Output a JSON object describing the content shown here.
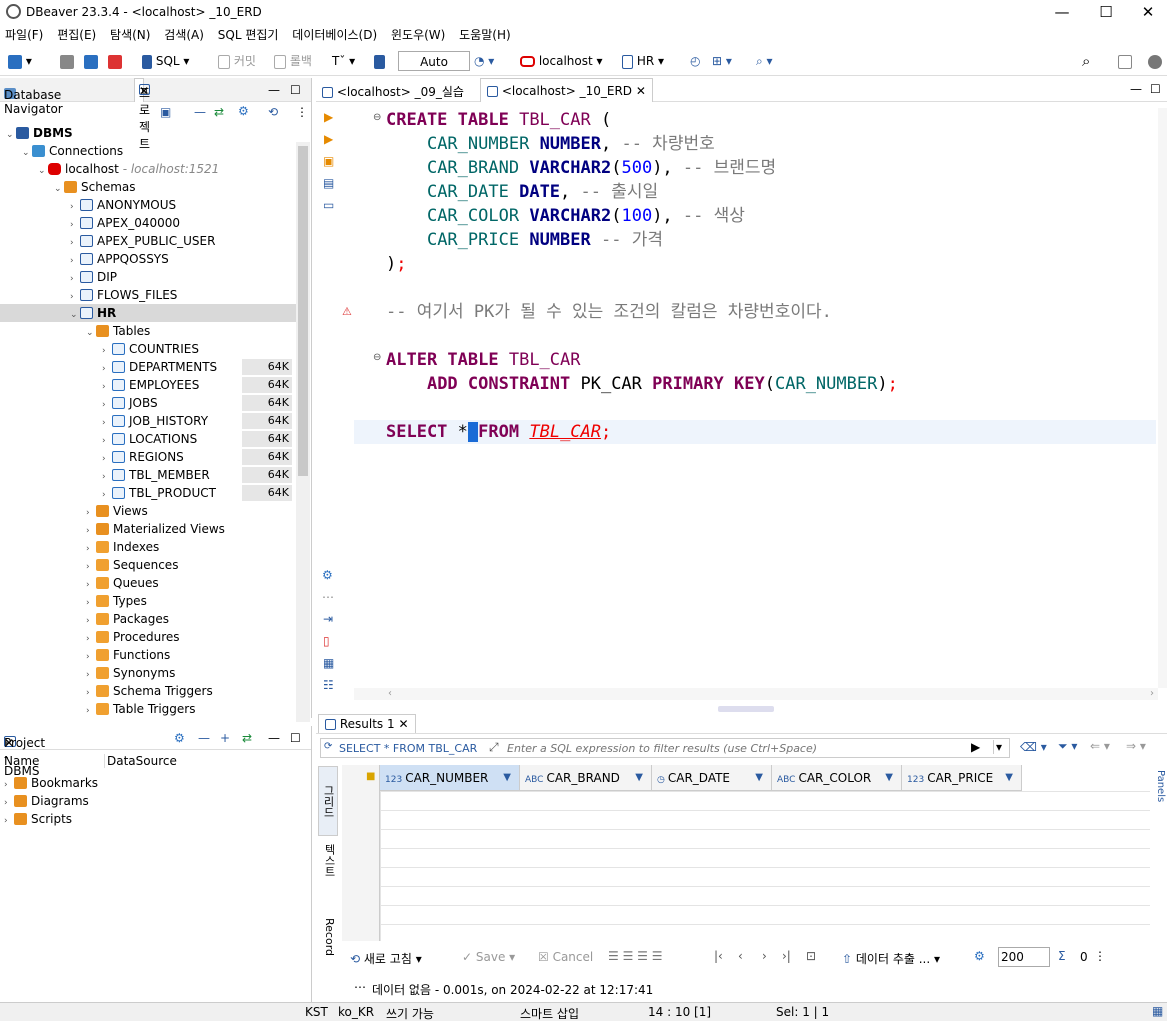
{
  "window": {
    "title": "DBeaver 23.3.4 - <localhost> _10_ERD",
    "minimize": "—",
    "maximize": "☐",
    "close": "✕"
  },
  "menu": [
    "파일(F)",
    "편집(E)",
    "탐색(N)",
    "검색(A)",
    "SQL 편집기",
    "데이터베이스(D)",
    "윈도우(W)",
    "도움말(H)"
  ],
  "toolbar": {
    "sql": "SQL",
    "commit": "커밋",
    "rollback": "롤백",
    "txmode": "Auto",
    "connection": "localhost",
    "schema": "HR"
  },
  "nav": {
    "tab1": "Database Navigator",
    "tab2": "프로젝트",
    "tree": [
      {
        "label": "DBMS",
        "depth": 0,
        "icon": "dbms",
        "bold": true
      },
      {
        "label": "Connections",
        "depth": 1,
        "icon": "connections"
      },
      {
        "label": "localhost",
        "depth": 2,
        "icon": "oracle",
        "note": " - localhost:1521"
      },
      {
        "label": "Schemas",
        "depth": 3,
        "icon": "schemas"
      },
      {
        "label": "ANONYMOUS",
        "depth": 4,
        "icon": "schema"
      },
      {
        "label": "APEX_040000",
        "depth": 4,
        "icon": "schema"
      },
      {
        "label": "APEX_PUBLIC_USER",
        "depth": 4,
        "icon": "schema"
      },
      {
        "label": "APPQOSSYS",
        "depth": 4,
        "icon": "schema"
      },
      {
        "label": "DIP",
        "depth": 4,
        "icon": "schema"
      },
      {
        "label": "FLOWS_FILES",
        "depth": 4,
        "icon": "schema"
      },
      {
        "label": "HR",
        "depth": 4,
        "icon": "schema",
        "bold": true,
        "selected": true
      },
      {
        "label": "Tables",
        "depth": 5,
        "icon": "tables"
      },
      {
        "label": "COUNTRIES",
        "depth": 6,
        "icon": "table"
      },
      {
        "label": "DEPARTMENTS",
        "depth": 6,
        "icon": "table",
        "size": "64K"
      },
      {
        "label": "EMPLOYEES",
        "depth": 6,
        "icon": "table",
        "size": "64K"
      },
      {
        "label": "JOBS",
        "depth": 6,
        "icon": "table",
        "size": "64K"
      },
      {
        "label": "JOB_HISTORY",
        "depth": 6,
        "icon": "table",
        "size": "64K"
      },
      {
        "label": "LOCATIONS",
        "depth": 6,
        "icon": "table",
        "size": "64K"
      },
      {
        "label": "REGIONS",
        "depth": 6,
        "icon": "table",
        "size": "64K"
      },
      {
        "label": "TBL_MEMBER",
        "depth": 6,
        "icon": "table",
        "size": "64K"
      },
      {
        "label": "TBL_PRODUCT",
        "depth": 6,
        "icon": "table",
        "size": "64K"
      },
      {
        "label": "Views",
        "depth": 5,
        "icon": "views"
      },
      {
        "label": "Materialized Views",
        "depth": 5,
        "icon": "views"
      },
      {
        "label": "Indexes",
        "depth": 5,
        "icon": "folder"
      },
      {
        "label": "Sequences",
        "depth": 5,
        "icon": "folder"
      },
      {
        "label": "Queues",
        "depth": 5,
        "icon": "folder"
      },
      {
        "label": "Types",
        "depth": 5,
        "icon": "folder"
      },
      {
        "label": "Packages",
        "depth": 5,
        "icon": "folder"
      },
      {
        "label": "Procedures",
        "depth": 5,
        "icon": "folder"
      },
      {
        "label": "Functions",
        "depth": 5,
        "icon": "folder"
      },
      {
        "label": "Synonyms",
        "depth": 5,
        "icon": "folder"
      },
      {
        "label": "Schema Triggers",
        "depth": 5,
        "icon": "folder"
      },
      {
        "label": "Table Triggers",
        "depth": 5,
        "icon": "folder"
      }
    ]
  },
  "project": {
    "tab": "Project - DBMS",
    "col_name": "Name",
    "col_source": "DataSource",
    "items": [
      "Bookmarks",
      "Diagrams",
      "Scripts"
    ]
  },
  "editor": {
    "tab1": "<localhost> _09_실습",
    "tab2": "<localhost> _10_ERD"
  },
  "results": {
    "tab": "Results 1",
    "query": "SELECT * FROM TBL_CAR",
    "filter_placeholder": "Enter a SQL expression to filter results (use Ctrl+Space)",
    "columns": [
      {
        "type": "123",
        "name": "CAR_NUMBER"
      },
      {
        "type": "ABC",
        "name": "CAR_BRAND"
      },
      {
        "type": "◷",
        "name": "CAR_DATE"
      },
      {
        "type": "ABC",
        "name": "CAR_COLOR"
      },
      {
        "type": "123",
        "name": "CAR_PRICE"
      }
    ],
    "side_grid": "그리드",
    "side_text": "텍스트",
    "side_record": "Record",
    "panels": "Panels",
    "refresh": "새로 고침",
    "save": "Save",
    "cancel": "Cancel",
    "export": "데이터 추출 ...",
    "limit": "200",
    "count": "0",
    "message": "데이터 없음 - 0.001s, on 2024-02-22 at 12:17:41"
  },
  "status": {
    "tz": "KST",
    "locale": "ko_KR",
    "mode": "쓰기 가능",
    "insert": "스마트 삽입",
    "pos": "14 : 10 [1]",
    "sel": "Sel: 1 | 1"
  },
  "colors": {
    "keyword": "#7f0055",
    "type": "#000080",
    "column": "#006666",
    "number": "#0000ff",
    "comment": "#7a7a7a",
    "accent": "#2a5aa0"
  }
}
